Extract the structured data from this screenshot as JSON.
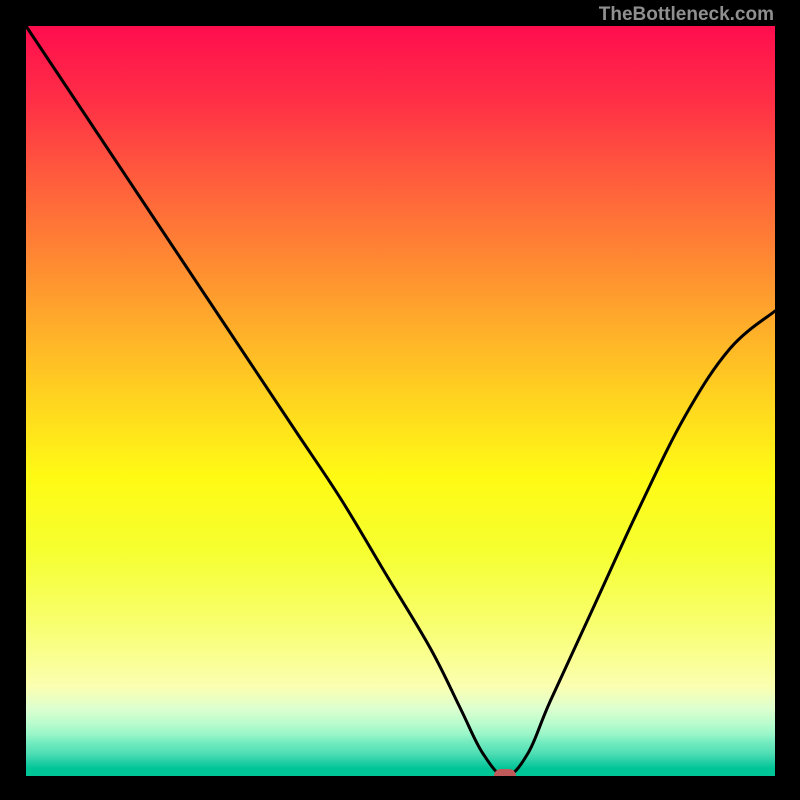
{
  "watermark": "TheBottleneck.com",
  "chart_data": {
    "type": "line",
    "title": "",
    "xlabel": "",
    "ylabel": "",
    "xlim": [
      0,
      100
    ],
    "ylim": [
      0,
      100
    ],
    "grid": false,
    "legend": false,
    "series": [
      {
        "name": "bottleneck-curve",
        "x": [
          0,
          6,
          12,
          18,
          24,
          30,
          36,
          42,
          48,
          54,
          58,
          61,
          64,
          67,
          70,
          76,
          82,
          88,
          94,
          100
        ],
        "values": [
          100,
          91,
          82,
          73,
          64,
          55,
          46,
          37,
          27,
          17,
          9,
          3,
          0,
          3,
          10,
          23,
          36,
          48,
          57,
          62
        ]
      }
    ],
    "marker": {
      "x": 64,
      "y": 0,
      "color": "#c05a5a"
    },
    "background": {
      "type": "vertical-gradient",
      "stops": [
        {
          "pos": 0.0,
          "color": "#ff0d4e"
        },
        {
          "pos": 0.5,
          "color": "#ffd51f"
        },
        {
          "pos": 0.88,
          "color": "#fbffb0"
        },
        {
          "pos": 1.0,
          "color": "#00c596"
        }
      ]
    }
  }
}
